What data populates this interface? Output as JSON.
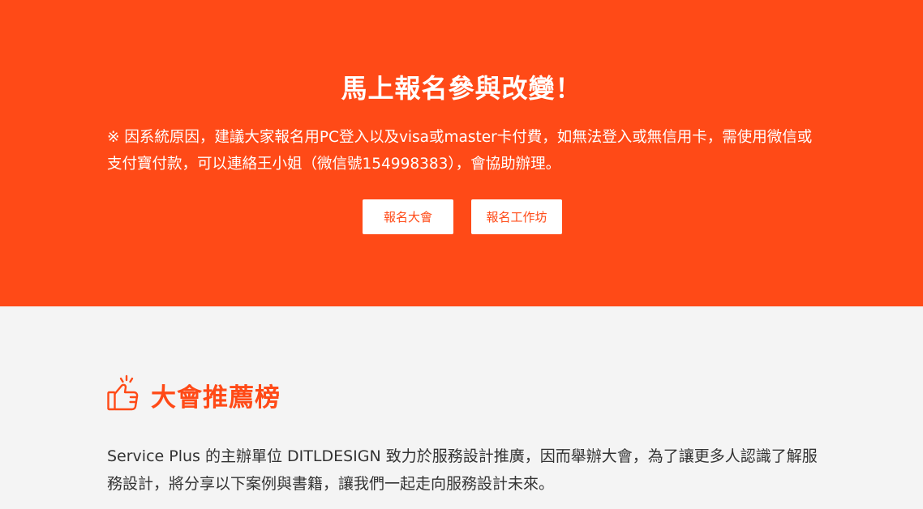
{
  "hero": {
    "title": "馬上報名參與改變！",
    "note": "※ 因系統原因，建議大家報名用PC登入以及visa或master卡付費，如無法登入或無信用卡，需使用微信或支付寶付款，可以連絡王小姐（微信號154998383），會協助辦理。",
    "buttons": {
      "register_conference": "報名大會",
      "register_workshop": "報名工作坊"
    }
  },
  "section": {
    "icon": "thumbs-up-icon",
    "title": "大會推薦榜",
    "body": "Service Plus 的主辦單位 DITLDESIGN 致力於服務設計推廣，因而舉辦大會，為了讓更多人認識了解服務設計，將分享以下案例與書籍，讓我們一起走向服務設計未來。"
  },
  "colors": {
    "accent": "#ff4a17",
    "background": "#f4f4f4",
    "text": "#333333"
  }
}
